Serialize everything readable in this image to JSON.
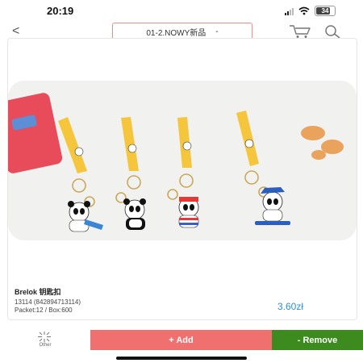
{
  "status_bar": {
    "time": "20:19",
    "battery": "34"
  },
  "nav": {
    "back": "<",
    "category": "01-2.NOWY新品",
    "category_caret": "-"
  },
  "product": {
    "name": "Brelok 钥匙扣",
    "code": "13114 (842894713114)",
    "packet": "Packet:12 / Box:600",
    "price": "3.60zł",
    "image_icon": "panda-keychains-photo"
  },
  "bottom_bar": {
    "other_label": "Other",
    "add_label": "+ Add",
    "remove_label": "- Remove"
  },
  "colors": {
    "add": "#f07070",
    "remove": "#3d8a1e",
    "price": "#2b8fd8",
    "select_border": "#f08a8a"
  }
}
